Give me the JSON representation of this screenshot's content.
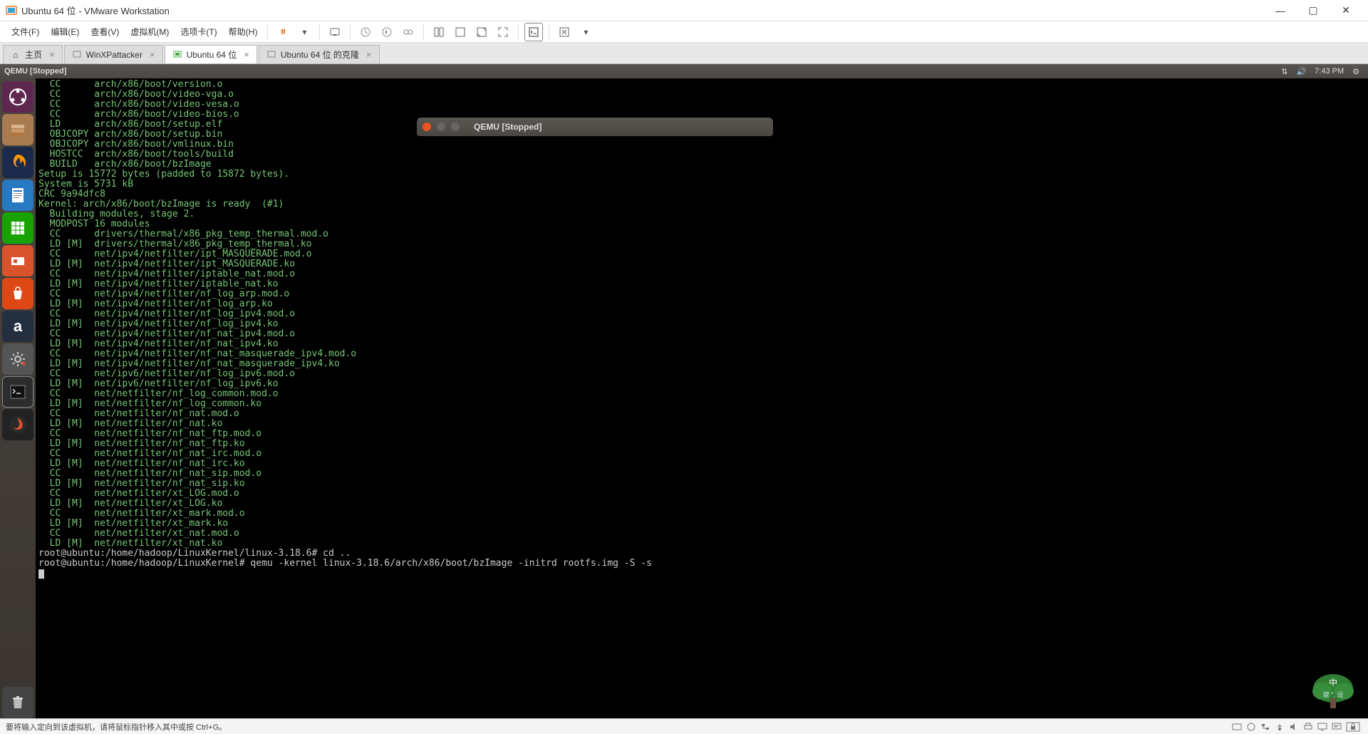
{
  "window": {
    "title": "Ubuntu 64 位 - VMware Workstation"
  },
  "menus": {
    "file": "文件(F)",
    "edit": "编辑(E)",
    "view": "查看(V)",
    "vm": "虚拟机(M)",
    "tabs": "选项卡(T)",
    "help": "帮助(H)"
  },
  "tabs": {
    "home": "主页",
    "t1": "WinXPattacker",
    "t2": "Ubuntu 64 位",
    "t3": "Ubuntu 64 位 的克隆"
  },
  "guest_top": {
    "title": "QEMU [Stopped]",
    "time": "7:43 PM"
  },
  "qemu_window": {
    "title": "QEMU [Stopped]"
  },
  "terminal": {
    "lines": [
      "  CC      arch/x86/boot/version.o",
      "  CC      arch/x86/boot/video-vga.o",
      "  CC      arch/x86/boot/video-vesa.o",
      "  CC      arch/x86/boot/video-bios.o",
      "  LD      arch/x86/boot/setup.elf",
      "  OBJCOPY arch/x86/boot/setup.bin",
      "  OBJCOPY arch/x86/boot/vmlinux.bin",
      "  HOSTCC  arch/x86/boot/tools/build",
      "  BUILD   arch/x86/boot/bzImage",
      "Setup is 15772 bytes (padded to 15872 bytes).",
      "System is 5731 kB",
      "CRC 9a94dfc8",
      "Kernel: arch/x86/boot/bzImage is ready  (#1)",
      "  Building modules, stage 2.",
      "  MODPOST 16 modules",
      "  CC      drivers/thermal/x86_pkg_temp_thermal.mod.o",
      "  LD [M]  drivers/thermal/x86_pkg_temp_thermal.ko",
      "  CC      net/ipv4/netfilter/ipt_MASQUERADE.mod.o",
      "  LD [M]  net/ipv4/netfilter/ipt_MASQUERADE.ko",
      "  CC      net/ipv4/netfilter/iptable_nat.mod.o",
      "  LD [M]  net/ipv4/netfilter/iptable_nat.ko",
      "  CC      net/ipv4/netfilter/nf_log_arp.mod.o",
      "  LD [M]  net/ipv4/netfilter/nf_log_arp.ko",
      "  CC      net/ipv4/netfilter/nf_log_ipv4.mod.o",
      "  LD [M]  net/ipv4/netfilter/nf_log_ipv4.ko",
      "  CC      net/ipv4/netfilter/nf_nat_ipv4.mod.o",
      "  LD [M]  net/ipv4/netfilter/nf_nat_ipv4.ko",
      "  CC      net/ipv4/netfilter/nf_nat_masquerade_ipv4.mod.o",
      "  LD [M]  net/ipv4/netfilter/nf_nat_masquerade_ipv4.ko",
      "  CC      net/ipv6/netfilter/nf_log_ipv6.mod.o",
      "  LD [M]  net/ipv6/netfilter/nf_log_ipv6.ko",
      "  CC      net/netfilter/nf_log_common.mod.o",
      "  LD [M]  net/netfilter/nf_log_common.ko",
      "  CC      net/netfilter/nf_nat.mod.o",
      "  LD [M]  net/netfilter/nf_nat.ko",
      "  CC      net/netfilter/nf_nat_ftp.mod.o",
      "  LD [M]  net/netfilter/nf_nat_ftp.ko",
      "  CC      net/netfilter/nf_nat_irc.mod.o",
      "  LD [M]  net/netfilter/nf_nat_irc.ko",
      "  CC      net/netfilter/nf_nat_sip.mod.o",
      "  LD [M]  net/netfilter/nf_nat_sip.ko",
      "  CC      net/netfilter/xt_LOG.mod.o",
      "  LD [M]  net/netfilter/xt_LOG.ko",
      "  CC      net/netfilter/xt_mark.mod.o",
      "  LD [M]  net/netfilter/xt_mark.ko",
      "  CC      net/netfilter/xt_nat.mod.o",
      "  LD [M]  net/netfilter/xt_nat.ko"
    ],
    "prompt1_user": "root@ubuntu",
    "prompt1_path": ":/home/hadoop/LinuxKernel/linux-3.18.6#",
    "prompt1_cmd": " cd ..",
    "prompt2_user": "root@ubuntu",
    "prompt2_path": ":/home/hadoop/LinuxKernel#",
    "prompt2_cmd": " qemu -kernel linux-3.18.6/arch/x86/boot/bzImage -initrd rootfs.img -S -s"
  },
  "statusbar": {
    "message": "要将输入定向到该虚拟机，请将鼠标指针移入其中或按 Ctrl+G。"
  },
  "tree_badge": {
    "line1": "中",
    "line2": "键 °, 设"
  },
  "colors": {
    "term_green": "#76c576",
    "term_white": "#cccccc",
    "ubuntu_orange": "#e95420",
    "vm_pause": "#e77828"
  }
}
